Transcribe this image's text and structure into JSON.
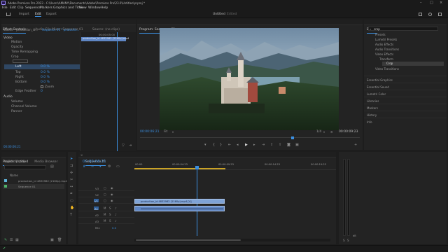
{
  "titlebar": {
    "title": "Adobe Premiere Pro 2023 - C:\\Users\\AMANY\\Documents\\Adobe\\Premiere Pro\\23.0\\Untitled.prproj *"
  },
  "menu": [
    "File",
    "Edit",
    "Clip",
    "Sequence",
    "Markers",
    "Graphics and Titles",
    "View",
    "Window",
    "Help"
  ],
  "workspace": {
    "tabs": [
      "Import",
      "Edit",
      "Export"
    ],
    "active": "Edit",
    "center_title": "Untitled",
    "center_sub": "Edited"
  },
  "effect_controls": {
    "tabs": [
      "Effect Controls",
      "Audio Clip Mixer: Sequence 01",
      "Source: (no clips)"
    ],
    "source_line": "Source * production_id... ",
    "seq_line": "Sequence 01 * productio...",
    "timecode_mini": "00:00:05:00",
    "clip_chip": "production_id 4832982 (2160p).mp4",
    "sections": {
      "video": "Video",
      "audio": "Audio"
    },
    "items": [
      "Motion",
      "Opacity",
      "Time Remapping",
      "Crop",
      "Left",
      "Top",
      "Right",
      "Bottom",
      "Zoom",
      "Edge Feather",
      "Volume",
      "Channel Volume",
      "Panner"
    ],
    "crop_values": [
      "0.0 %",
      "0.0 %",
      "0.0 %",
      "0.0 %"
    ],
    "edge_value": "0",
    "timecode": "00:00:06:21"
  },
  "program": {
    "title": "Program: Sequence 01",
    "timecode_left": "00:00:06:21",
    "zoom": "Fit",
    "quality": "1/4",
    "timecode_right": "00:00:09:23"
  },
  "effects": {
    "title": "Effects",
    "search": "crop",
    "tree": [
      "Presets",
      "Lumetri Presets",
      "Audio Effects",
      "Audio Transitions",
      "Video Effects",
      "Transform",
      "Crop",
      "Video Transitions"
    ],
    "panels": [
      "Essential Graphics",
      "Essential Sound",
      "Lumetri Color",
      "Libraries",
      "Markers",
      "History",
      "Info"
    ]
  },
  "project": {
    "tabs": [
      "Project: Untitled",
      "Media Browser"
    ],
    "file": "Untitled.prproj",
    "col_name": "Name",
    "items": [
      "production_id 4832982 (2160p).mp4",
      "Sequence 01"
    ]
  },
  "timeline": {
    "tab": "Sequence 01",
    "timecode": "00:00:06:21",
    "ruler": [
      "00:00",
      "00:00:04:23",
      "00:00:09:23",
      "00:00:14:23",
      "00:00:19:23"
    ],
    "tracks_video": [
      "V3",
      "V2",
      "V1"
    ],
    "tracks_audio": [
      "A1",
      "A2",
      "A3"
    ],
    "mix": "Mix",
    "mix_val": "0.0",
    "clip_video": "production_id 4832982 (2160p).mp4 [V]",
    "meter_labels": [
      "0",
      "-6",
      "-12",
      "-18",
      "-24",
      "-30",
      "-36",
      "-42",
      "-48",
      "-54",
      "dB"
    ]
  },
  "colors": {
    "accent": "#3b8fe0",
    "clip_video": "#7fa3d6",
    "clip_audio": "#5f86c4",
    "playhead": "#3b8fe0"
  }
}
